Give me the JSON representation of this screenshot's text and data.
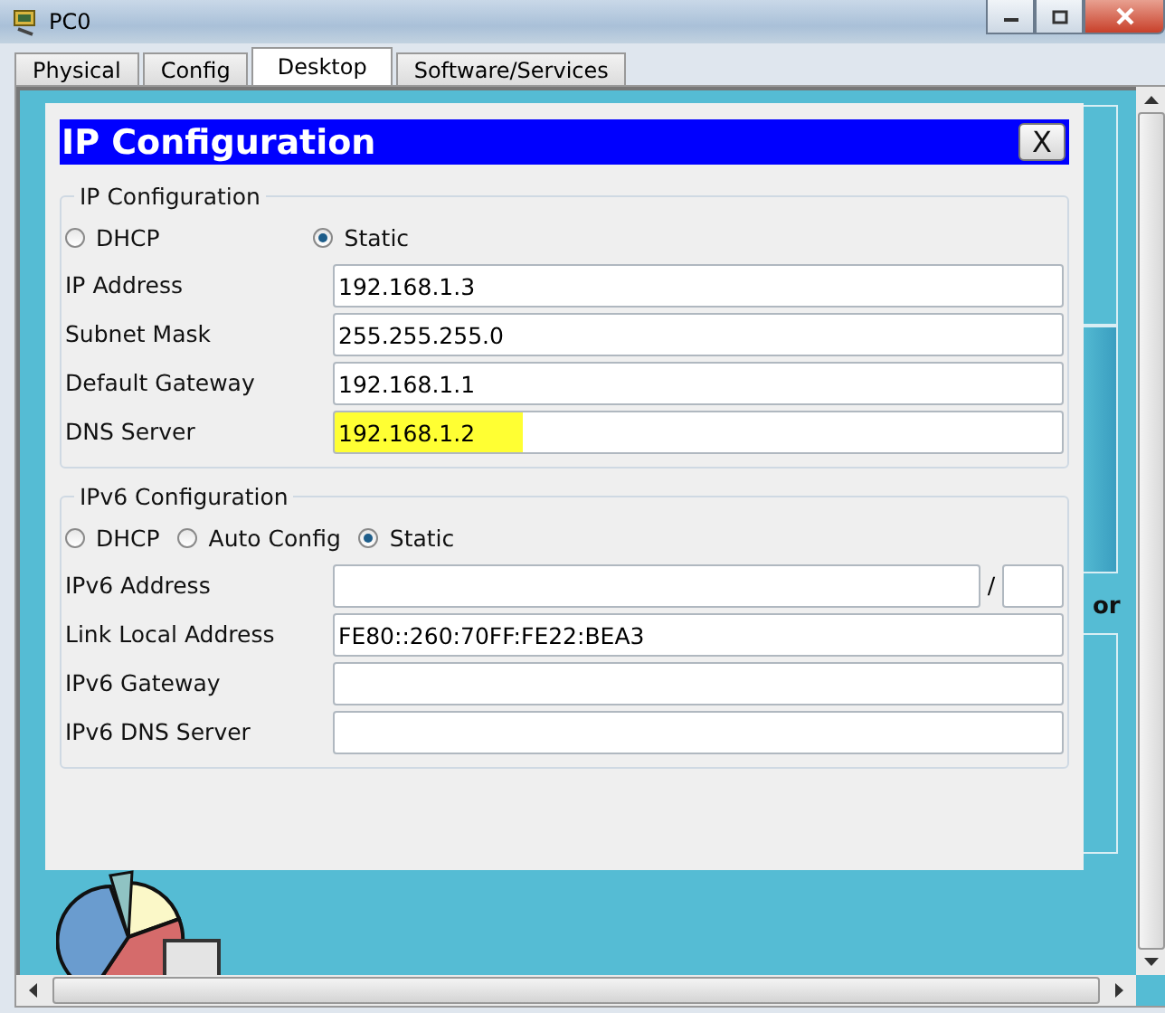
{
  "window": {
    "title": "PC0"
  },
  "tabs": [
    {
      "label": "Physical",
      "selected": false
    },
    {
      "label": "Config",
      "selected": false
    },
    {
      "label": "Desktop",
      "selected": true
    },
    {
      "label": "Software/Services",
      "selected": false
    }
  ],
  "desktop": {
    "label_fragment": "or"
  },
  "dialog": {
    "title": "IP Configuration",
    "close_label": "X",
    "ipv4": {
      "title": "IP Configuration",
      "modes": [
        {
          "label": "DHCP",
          "selected": false
        },
        {
          "label": "Static",
          "selected": true
        }
      ],
      "fields": [
        {
          "kind": "text",
          "label": "IP Address",
          "value": "192.168.1.3",
          "highlighted": false
        },
        {
          "kind": "text",
          "label": "Subnet Mask",
          "value": "255.255.255.0",
          "highlighted": false
        },
        {
          "kind": "text",
          "label": "Default Gateway",
          "value": "192.168.1.1",
          "highlighted": false
        },
        {
          "kind": "text",
          "label": "DNS Server",
          "value": "192.168.1.2",
          "highlighted": true
        }
      ]
    },
    "ipv6": {
      "title": "IPv6 Configuration",
      "modes": [
        {
          "label": "DHCP",
          "selected": false
        },
        {
          "label": "Auto Config",
          "selected": false
        },
        {
          "label": "Static",
          "selected": true
        }
      ],
      "fields": [
        {
          "kind": "prefix",
          "label": "IPv6 Address",
          "separator": "/",
          "highlighted": false
        },
        {
          "kind": "text",
          "label": "Link Local Address",
          "value": "FE80::260:70FF:FE22:BEA3",
          "highlighted": false
        },
        {
          "kind": "text",
          "label": "IPv6 Gateway",
          "highlighted": false
        },
        {
          "kind": "text",
          "label": "IPv6 DNS Server",
          "highlighted": false
        }
      ]
    }
  }
}
